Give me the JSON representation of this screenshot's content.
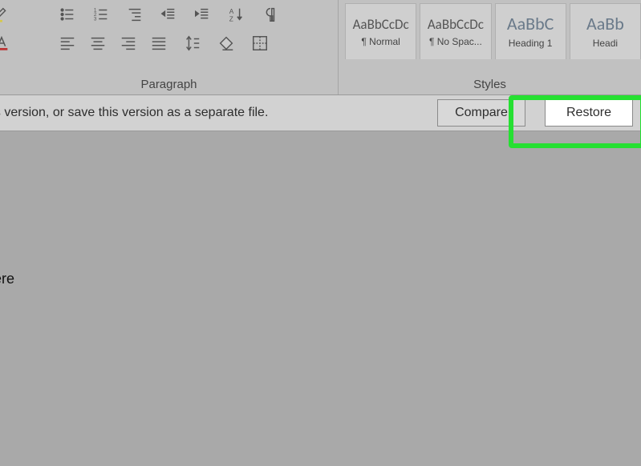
{
  "ribbon": {
    "paragraph": {
      "label": "Paragraph",
      "icons_row1": [
        "bullets",
        "numbering",
        "multilevel",
        "outdent",
        "indent",
        "sort-az",
        "show-marks"
      ],
      "icons_row2": [
        "align-left",
        "align-center",
        "align-right",
        "justify",
        "line-spacing",
        "shading",
        "borders"
      ]
    },
    "styles": {
      "label": "Styles",
      "tiles": [
        {
          "sample": "AaBbCcDc",
          "name": "¶ Normal"
        },
        {
          "sample": "AaBbCcDc",
          "name": "¶ No Spac..."
        },
        {
          "sample": "AaBbC",
          "name": "Heading 1",
          "big": true
        },
        {
          "sample": "AaBb",
          "name": "Headi",
          "big": true
        }
      ]
    },
    "left_crop": [
      "highlight",
      "font-color"
    ]
  },
  "message_bar": {
    "text": "this version, or save this version as a separate file.",
    "compare_label": "Compare",
    "restore_label": "Restore"
  },
  "document": {
    "visible_text": "ere"
  },
  "highlight": {
    "color": "#26e032"
  }
}
